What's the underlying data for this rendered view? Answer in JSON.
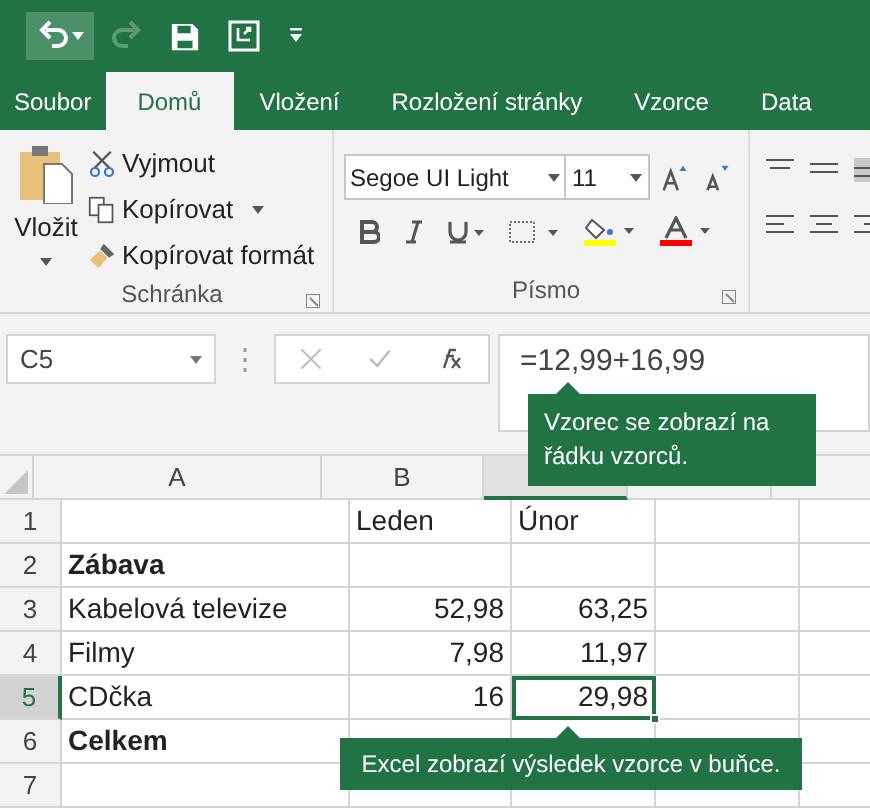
{
  "ribbon_tabs": [
    {
      "label": "Soubor",
      "selected": false
    },
    {
      "label": "Domů",
      "selected": true
    },
    {
      "label": "Vložení",
      "selected": false
    },
    {
      "label": "Rozložení stránky",
      "selected": false
    },
    {
      "label": "Vzorce",
      "selected": false
    },
    {
      "label": "Data",
      "selected": false
    }
  ],
  "clipboard": {
    "paste": "Vložit",
    "cut": "Vyjmout",
    "copy": "Kopírovat",
    "format_painter": "Kopírovat formát",
    "group": "Schránka"
  },
  "font": {
    "name": "Segoe UI Light",
    "size": "11",
    "group": "Písmo"
  },
  "formula_bar": {
    "name_box": "C5",
    "formula": "=12,99+16,99"
  },
  "columns": [
    {
      "label": "A",
      "selected": false
    },
    {
      "label": "B",
      "selected": false
    },
    {
      "selected": true
    },
    {
      "selected": false
    },
    {
      "selected": false
    }
  ],
  "rows": [
    {
      "number": "1",
      "selected": false,
      "cells": [
        null,
        {
          "text": "Leden",
          "kind": "text",
          "bold": false,
          "active": false
        },
        {
          "text": "Únor",
          "kind": "text",
          "bold": false,
          "active": false
        }
      ]
    },
    {
      "number": "2",
      "selected": false,
      "cells": [
        {
          "text": "Zábava",
          "kind": "text",
          "bold": true,
          "active": false
        }
      ]
    },
    {
      "number": "3",
      "selected": false,
      "cells": [
        {
          "text": "Kabelová televize",
          "kind": "text",
          "bold": false,
          "active": false
        },
        {
          "text": "52,98",
          "kind": "number",
          "bold": false,
          "active": false
        },
        {
          "text": "63,25",
          "kind": "number",
          "bold": false,
          "active": false
        }
      ]
    },
    {
      "number": "4",
      "selected": false,
      "cells": [
        {
          "text": "Filmy",
          "kind": "text",
          "bold": false,
          "active": false
        },
        {
          "text": "7,98",
          "kind": "number",
          "bold": false,
          "active": false
        },
        {
          "text": "11,97",
          "kind": "number",
          "bold": false,
          "active": false
        }
      ]
    },
    {
      "number": "5",
      "selected": true,
      "cells": [
        {
          "text": "CDčka",
          "kind": "text",
          "bold": false,
          "active": false
        },
        {
          "text": "16",
          "kind": "number",
          "bold": false,
          "active": false
        },
        {
          "text": "29,98",
          "kind": "number",
          "bold": false,
          "active": true
        }
      ]
    },
    {
      "number": "6",
      "selected": false,
      "cells": [
        {
          "text": "Celkem",
          "kind": "text",
          "bold": true,
          "active": false
        }
      ]
    },
    {
      "number": "7",
      "selected": false
    }
  ],
  "callouts": {
    "formula": "Vzorec se zobrazí na řádku vzorců.",
    "cell": "Excel zobrazí výsledek vzorce v buňce."
  }
}
